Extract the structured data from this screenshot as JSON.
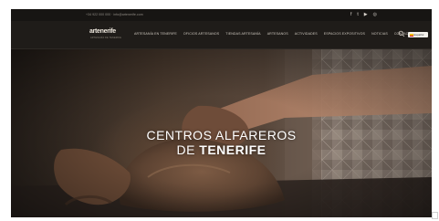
{
  "topbar": {
    "contact": "+34 922 000 000  ·  info@artenerife.com",
    "social": [
      {
        "icon": "facebook-icon",
        "glyph": "f"
      },
      {
        "icon": "twitter-icon",
        "glyph": "t"
      },
      {
        "icon": "youtube-icon",
        "glyph": "▶"
      },
      {
        "icon": "instagram-icon",
        "glyph": "◎"
      }
    ]
  },
  "nav": {
    "logo_text": "artenerife",
    "logo_tagline": "ARTESANÍA DE TENERIFE",
    "items": [
      "ARTESANÍA EN TENERIFE",
      "OFICIOS ARTESANOS",
      "TIENDAS ARTESANÍA",
      "ARTESANOS",
      "ACTIVIDADES",
      "ESPACIOS EXPOSITIVOS",
      "NOTICIAS",
      "CONTACTO"
    ],
    "search_icon": "search-icon",
    "language": "Español",
    "language_flag_colors": [
      "#c8102e",
      "#f1bf00"
    ]
  },
  "hero": {
    "line1": "CENTROS ALFAREROS",
    "line2_prefix": "DE ",
    "line2_bold": "TENERIFE"
  }
}
